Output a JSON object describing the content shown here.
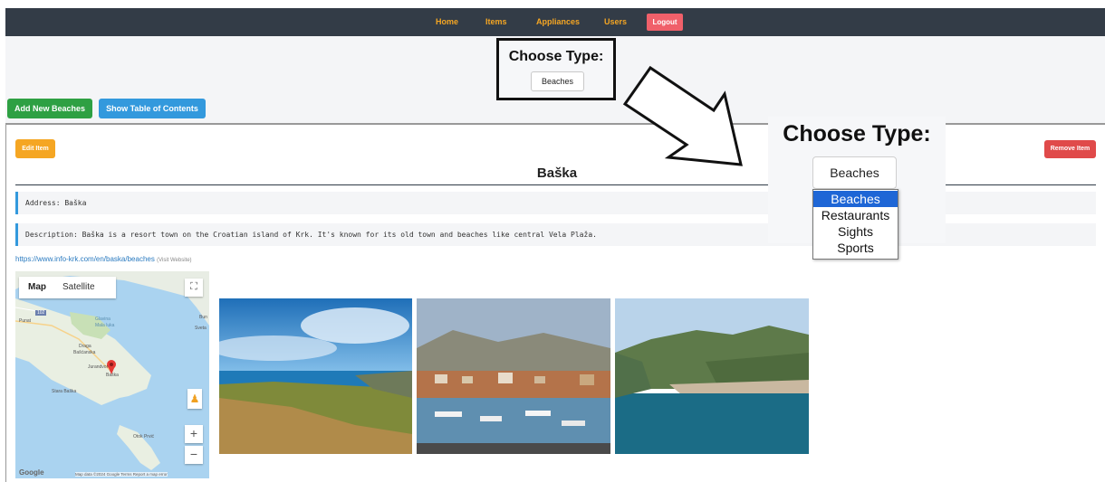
{
  "nav": {
    "home": "Home",
    "items": "Items",
    "appliances": "Appliances",
    "users": "Users",
    "logout": "Logout"
  },
  "type_selector": {
    "label": "Choose Type:",
    "selected": "Beaches"
  },
  "actions": {
    "add_new": "Add New Beaches",
    "show_toc": "Show Table of Contents"
  },
  "item": {
    "edit": "Edit Item",
    "remove": "Remove Item",
    "title": "Baška",
    "address": "Address: Baška",
    "description": "Description: Baška is a resort town on the Croatian island of Krk. It's known for its old town and beaches like central Vela Plaža.",
    "link": "https://www.info-krk.com/en/baska/beaches",
    "link_note": "(Visit Website)"
  },
  "map": {
    "tab_map": "Map",
    "tab_satellite": "Satellite",
    "labels": {
      "punat": "Punat",
      "glavina": "Glavina",
      "mala_luka": "Mala luka",
      "draga": "Draga",
      "bascanska": "Bašćanska",
      "jurandvor": "Jurandvor",
      "baska": "Baška",
      "stara_baska": "Stara Baška",
      "otok_prvic": "Otok Prvić",
      "bun": "Bun",
      "sveta": "Sveta",
      "road": "102"
    },
    "google": "Google",
    "footer": "Map data ©2024 Google   Terms   Report a map error",
    "zoom_in": "+",
    "zoom_out": "−"
  },
  "zoom_overlay": {
    "label": "Choose Type:",
    "selected": "Beaches",
    "options": [
      "Beaches",
      "Restaurants",
      "Sights",
      "Sports"
    ]
  },
  "colors": {
    "nav_bg": "#333c47",
    "nav_text": "#f5a623",
    "logout": "#f0606a",
    "add_button": "#2ea043",
    "toc_button": "#3399dd",
    "edit_button": "#f5a623",
    "remove_button": "#e04a4a",
    "option_highlight": "#1e66d6"
  }
}
